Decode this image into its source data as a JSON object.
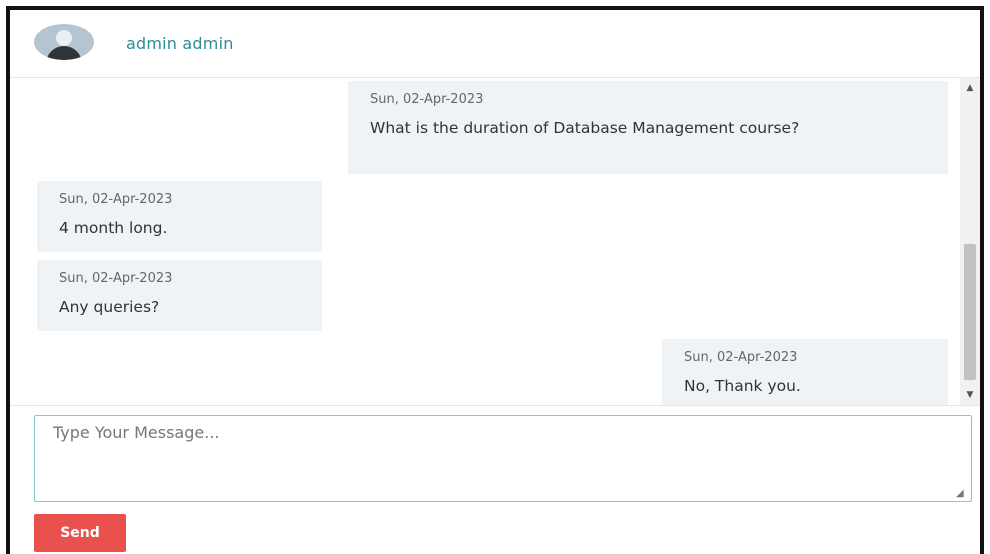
{
  "header": {
    "contact_name": "admin admin",
    "avatar_icon": "user-avatar-icon"
  },
  "messages": [
    {
      "side": "right",
      "date": "Sun, 02-Apr-2023",
      "text": "What is the duration of Database Management course?"
    },
    {
      "side": "left",
      "date": "Sun, 02-Apr-2023",
      "text": "4 month long."
    },
    {
      "side": "left",
      "date": "Sun, 02-Apr-2023",
      "text": "Any queries?"
    },
    {
      "side": "right",
      "date": "Sun, 02-Apr-2023",
      "text": "No, Thank you."
    }
  ],
  "composer": {
    "placeholder": "Type Your Message...",
    "value": "",
    "send_label": "Send"
  },
  "scrollbar": {
    "up_icon": "scroll-up-arrow-icon",
    "down_icon": "scroll-down-arrow-icon"
  },
  "colors": {
    "accent_name": "#2b8c97",
    "bubble_bg": "#f0f3f5",
    "send_button": "#e9514e",
    "input_border": "#8fc3d6"
  }
}
